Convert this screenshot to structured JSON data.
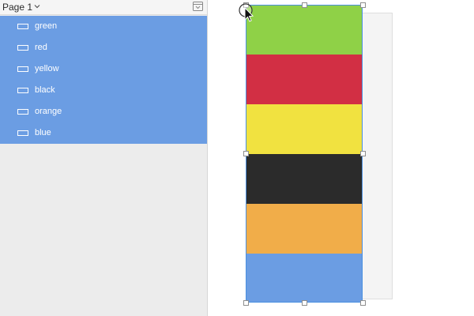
{
  "panel": {
    "page_title": "Page 1",
    "chevron_icon": "chevron-down-icon",
    "collapse_icon": "collapse-panel-icon"
  },
  "layers": [
    {
      "label": "green",
      "icon": "rectangle-icon"
    },
    {
      "label": "red",
      "icon": "rectangle-icon"
    },
    {
      "label": "yellow",
      "icon": "rectangle-icon"
    },
    {
      "label": "black",
      "icon": "rectangle-icon"
    },
    {
      "label": "orange",
      "icon": "rectangle-icon"
    },
    {
      "label": "blue",
      "icon": "rectangle-icon"
    }
  ],
  "colors": {
    "selection": "#6b9de3",
    "green": "#8fd147",
    "red": "#d22f44",
    "yellow": "#f1e240",
    "black": "#2b2b2b",
    "orange": "#f1ad49",
    "blue": "#6b9de3"
  },
  "canvas": {
    "swatch_order": [
      "green",
      "red",
      "yellow",
      "black",
      "orange",
      "blue"
    ]
  }
}
